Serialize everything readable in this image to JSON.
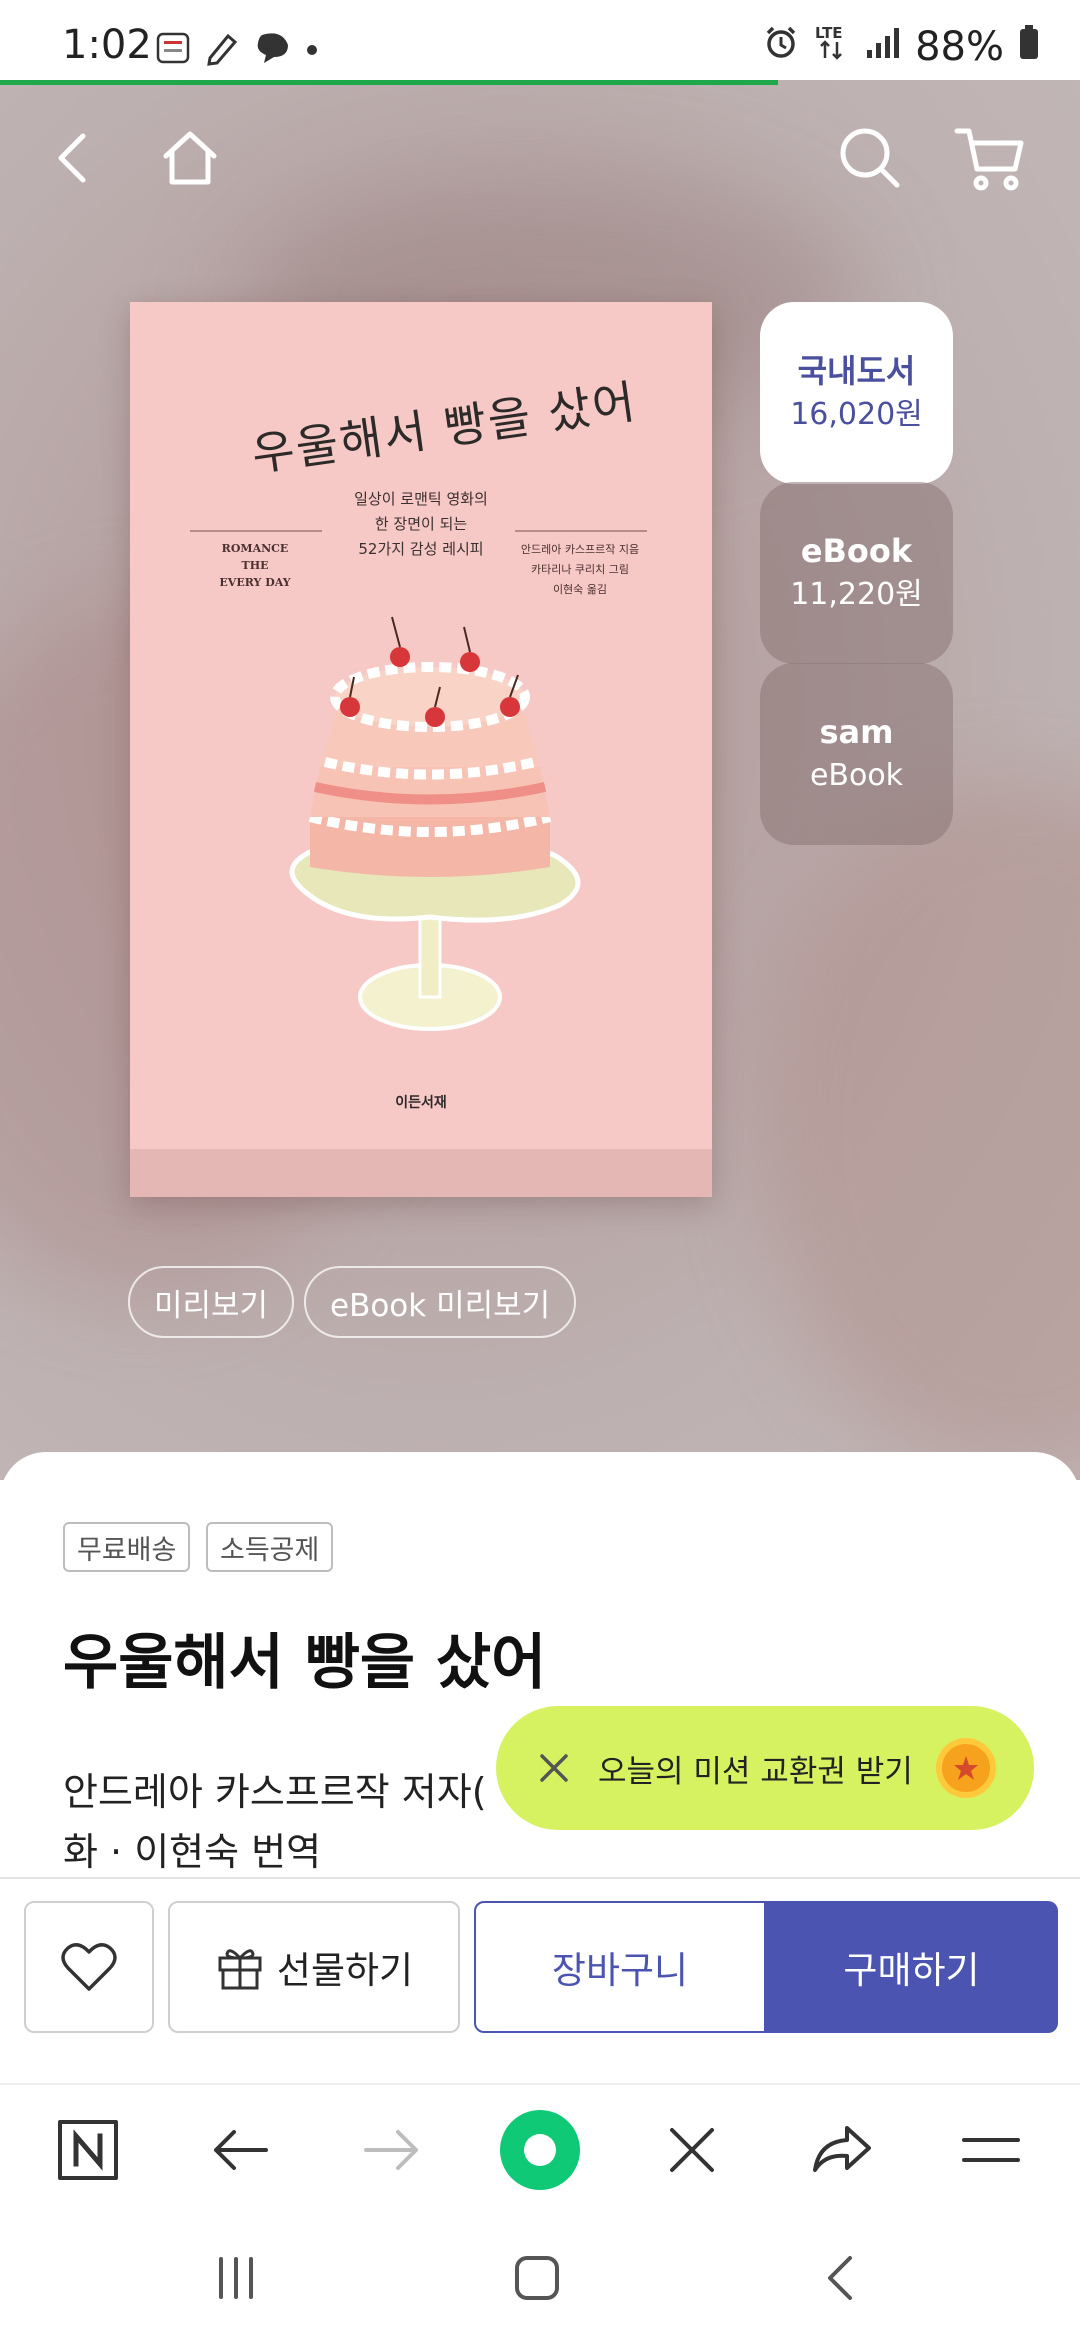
{
  "status_bar": {
    "time": "1:02",
    "network": "LTE",
    "battery": "88%"
  },
  "page_progress_percent": 72,
  "book": {
    "cover_title": "우울해서 빵을 샀어",
    "cover_subtitle": "일상이 로맨틱 영화의\n한 장면이 되는\n52가지 감성 레시피",
    "cover_english": "ROMANCE\nTHE\nEVERY DAY",
    "cover_authors": "안드레아 카스프르작 지음\n카타리나 쿠리치 그림\n이현숙 옮김",
    "cover_publisher": "이든서재"
  },
  "formats": [
    {
      "name": "국내도서",
      "price": "16,020원",
      "selected": true
    },
    {
      "name": "eBook",
      "price": "11,220원",
      "selected": false
    },
    {
      "name": "sam",
      "price": "eBook",
      "selected": false
    }
  ],
  "preview": {
    "preview_label": "미리보기",
    "ebook_preview_label": "eBook 미리보기"
  },
  "info": {
    "tags": [
      "무료배송",
      "소득공제"
    ],
    "title": "우울해서 빵을 샀어",
    "author_line": "안드레아 카스프르작 저자(",
    "author_line2": "화 · 이현숙 번역"
  },
  "mission": {
    "label": "오늘의 미션 교환권 받기"
  },
  "actions": {
    "gift_label": "선물하기",
    "cart_label": "장바구니",
    "buy_label": "구매하기"
  },
  "colors": {
    "accent": "#4b54b0",
    "mission_bg": "#d6f261",
    "progress": "#1ea84a"
  }
}
